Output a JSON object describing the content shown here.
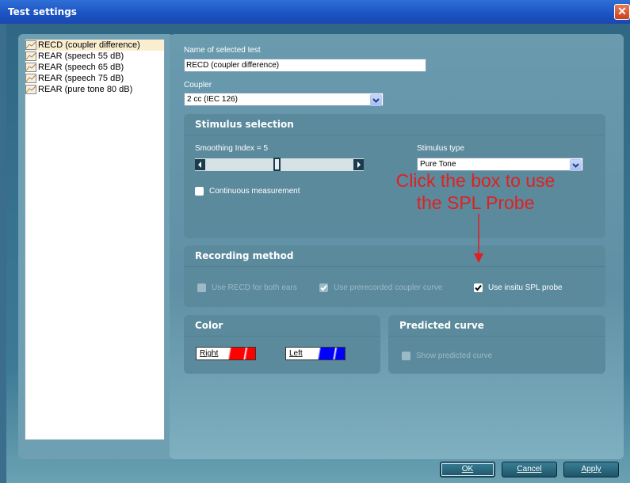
{
  "window": {
    "title": "Test settings"
  },
  "tests": [
    {
      "label": "RECD (coupler difference)",
      "selected": true
    },
    {
      "label": "REAR (speech 55 dB)",
      "selected": false
    },
    {
      "label": "REAR (speech 65 dB)",
      "selected": false
    },
    {
      "label": "REAR (speech 75 dB)",
      "selected": false
    },
    {
      "label": "REAR (pure tone 80 dB)",
      "selected": false
    }
  ],
  "name": {
    "label": "Name of selected test",
    "value": "RECD (coupler difference)"
  },
  "coupler": {
    "label": "Coupler",
    "value": "2 cc (IEC 126)"
  },
  "stimulus": {
    "title": "Stimulus selection",
    "smoothing_label": "Smoothing Index = 5",
    "smoothing_value": 5,
    "type_label": "Stimulus type",
    "type_value": "Pure Tone",
    "continuous_label": "Continuous measurement",
    "continuous_checked": false
  },
  "recording": {
    "title": "Recording method",
    "recd_both": {
      "label": "Use RECD for both ears",
      "checked": false,
      "enabled": false
    },
    "prerecorded": {
      "label": "Use prerecorded coupler curve",
      "checked": true,
      "enabled": false
    },
    "insitu": {
      "label": "Use insitu SPL probe",
      "checked": true,
      "enabled": true
    }
  },
  "color": {
    "title": "Color",
    "right": {
      "label": "Right",
      "color": "#ff0000"
    },
    "left": {
      "label": "Left",
      "color": "#0000ff"
    }
  },
  "predicted": {
    "title": "Predicted curve",
    "show_label": "Show predicted curve",
    "checked": false
  },
  "annotation": {
    "line1": "Click the box to use",
    "line2": "the SPL Probe",
    "color": "#e02020"
  },
  "buttons": {
    "ok": "OK",
    "cancel": "Cancel",
    "apply": "Apply"
  }
}
